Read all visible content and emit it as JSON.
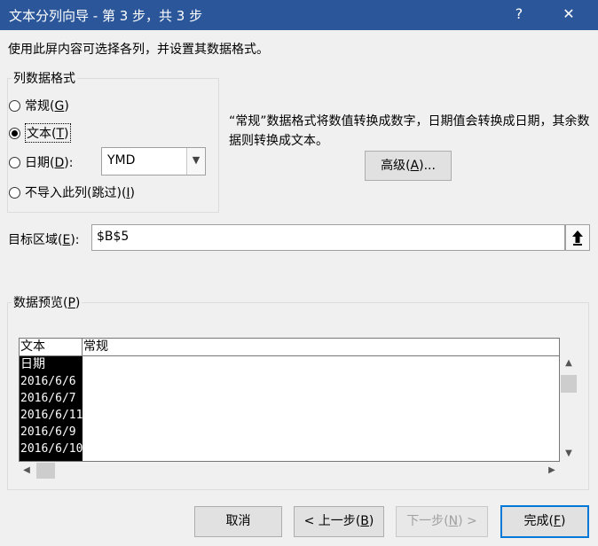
{
  "window": {
    "title": "文本分列向导 - 第 3 步，共 3 步",
    "help_glyph": "?",
    "close_glyph": "✕"
  },
  "instruction": "使用此屏内容可选择各列，并设置其数据格式。",
  "column_format": {
    "legend": "列数据格式",
    "options": [
      {
        "label": "常规",
        "key": "G",
        "selected": false
      },
      {
        "label": "文本",
        "key": "T",
        "selected": true
      },
      {
        "label": "日期",
        "key": "D",
        "selected": false
      },
      {
        "label": "不导入此列(跳过)",
        "key": "I",
        "selected": false
      }
    ],
    "date_format_value": "YMD"
  },
  "description": "“常规”数据格式将数值转换成数字，日期值会转换成日期，其余数据则转换成文本。",
  "advanced_button": {
    "label": "高级",
    "key": "A",
    "suffix": "..."
  },
  "destination": {
    "label": "目标区域",
    "key": "E",
    "value": "$B$5"
  },
  "preview": {
    "legend": "数据预览",
    "key": "P",
    "headers": [
      "文本",
      "常规"
    ],
    "rows": [
      "日期",
      "2016/6/6",
      "2016/6/7",
      "2016/6/11",
      "2016/6/9",
      "2016/6/10"
    ]
  },
  "buttons": {
    "cancel": "取消",
    "back": {
      "label": "< 上一步",
      "key": "B"
    },
    "next": {
      "label": "下一步",
      "key": "N",
      "suffix": " >"
    },
    "finish": {
      "label": "完成",
      "key": "F"
    }
  }
}
